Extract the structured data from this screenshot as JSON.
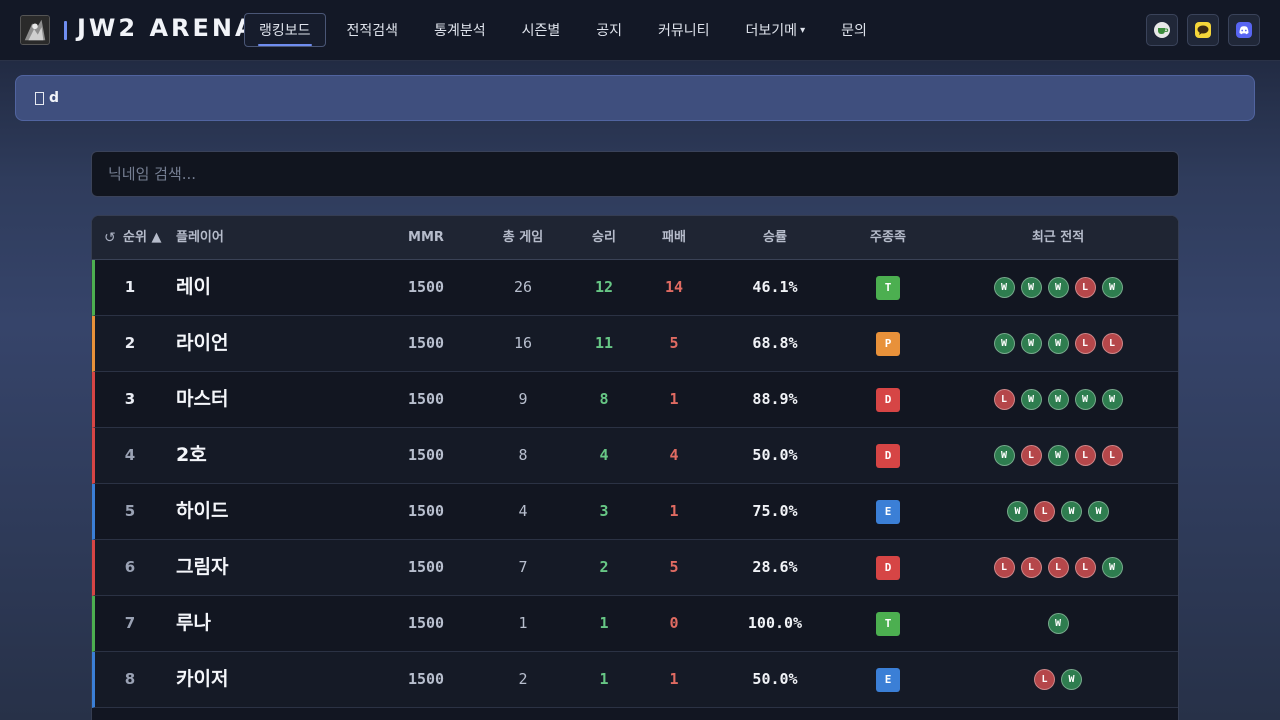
{
  "header": {
    "logo_text": "JW2 ARENA",
    "nav": [
      "랭킹보드",
      "전적검색",
      "통계분석",
      "시즌별",
      "공지",
      "커뮤니티",
      "더보기메",
      "문의"
    ],
    "more_caret": "▾",
    "icons": [
      "coffee-icon",
      "kakaotalk-icon",
      "discord-icon"
    ]
  },
  "notice": {
    "text": "d"
  },
  "search": {
    "placeholder": "닉네임 검색..."
  },
  "table": {
    "refresh_icon": "↺",
    "columns": {
      "rank": "순위 ▲",
      "nickname": "플레이어",
      "mmr": "MMR",
      "games": "총 게임",
      "wins": "승리",
      "losses": "패배",
      "winrate": "승률",
      "tier": "주종족",
      "recent": "최근 전적"
    },
    "rows": [
      {
        "rank": "1",
        "nick": "레이",
        "mmr": "1500",
        "games": "26",
        "wins": "12",
        "losses": "14",
        "rate": "46.1%",
        "tier": "T",
        "tier_color": "#4caf50",
        "bar_color": "#4caf50",
        "recent": [
          "W",
          "W",
          "W",
          "L",
          "W"
        ]
      },
      {
        "rank": "2",
        "nick": "라이언",
        "mmr": "1500",
        "games": "16",
        "wins": "11",
        "losses": "5",
        "rate": "68.8%",
        "tier": "P",
        "tier_color": "#e8913a",
        "bar_color": "#e8913a",
        "recent": [
          "W",
          "W",
          "W",
          "L",
          "L"
        ]
      },
      {
        "rank": "3",
        "nick": "마스터",
        "mmr": "1500",
        "games": "9",
        "wins": "8",
        "losses": "1",
        "rate": "88.9%",
        "tier": "D",
        "tier_color": "#d64545",
        "bar_color": "#d64545",
        "recent": [
          "L",
          "W",
          "W",
          "W",
          "W"
        ]
      },
      {
        "rank": "4",
        "nick": "2호",
        "mmr": "1500",
        "games": "8",
        "wins": "4",
        "losses": "4",
        "rate": "50.0%",
        "tier": "D",
        "tier_color": "#d64545",
        "bar_color": "#d64545",
        "recent": [
          "W",
          "L",
          "W",
          "L",
          "L"
        ]
      },
      {
        "rank": "5",
        "nick": "하이드",
        "mmr": "1500",
        "games": "4",
        "wins": "3",
        "losses": "1",
        "rate": "75.0%",
        "tier": "E",
        "tier_color": "#3b7fd6",
        "bar_color": "#3b7fd6",
        "recent": [
          "W",
          "L",
          "W",
          "W"
        ]
      },
      {
        "rank": "6",
        "nick": "그림자",
        "mmr": "1500",
        "games": "7",
        "wins": "2",
        "losses": "5",
        "rate": "28.6%",
        "tier": "D",
        "tier_color": "#d64545",
        "bar_color": "#d64545",
        "recent": [
          "L",
          "L",
          "L",
          "L",
          "W"
        ]
      },
      {
        "rank": "7",
        "nick": "루나",
        "mmr": "1500",
        "games": "1",
        "wins": "1",
        "losses": "0",
        "rate": "100.0%",
        "tier": "T",
        "tier_color": "#4caf50",
        "bar_color": "#4caf50",
        "recent": [
          "W"
        ]
      },
      {
        "rank": "8",
        "nick": "카이저",
        "mmr": "1500",
        "games": "2",
        "wins": "1",
        "losses": "1",
        "rate": "50.0%",
        "tier": "E",
        "tier_color": "#3b7fd6",
        "bar_color": "#3b7fd6",
        "recent": [
          "L",
          "W"
        ]
      }
    ]
  }
}
